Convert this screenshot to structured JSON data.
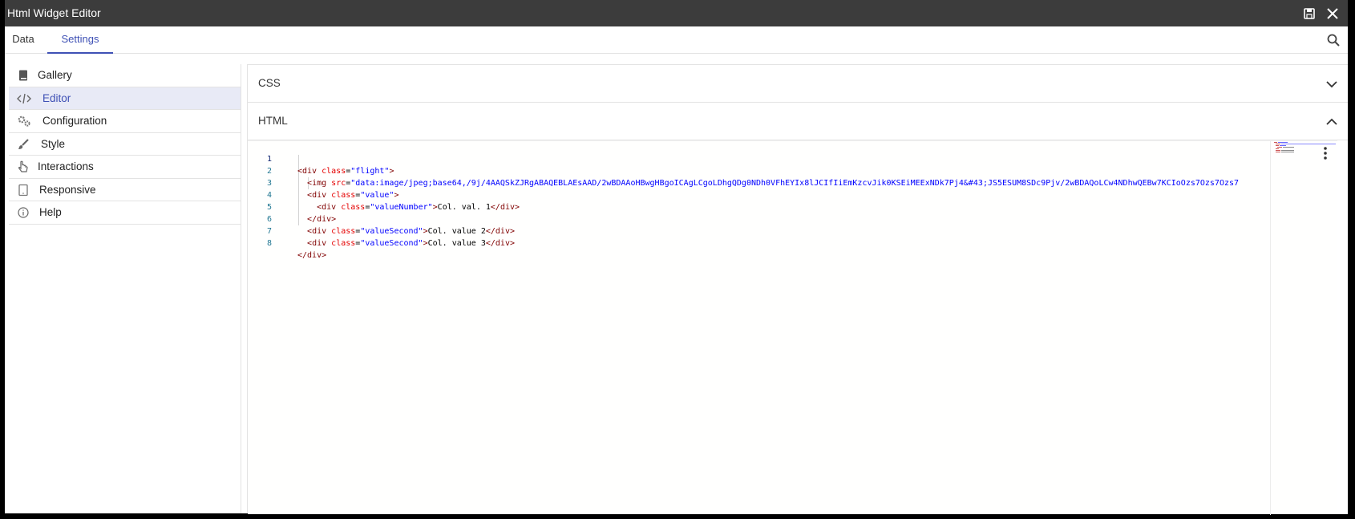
{
  "window": {
    "title": "Html Widget Editor"
  },
  "titlebar": {
    "save_icon": "save-icon",
    "close_icon": "close-icon"
  },
  "tabs": [
    {
      "label": "Data",
      "active": false
    },
    {
      "label": "Settings",
      "active": true
    }
  ],
  "search_icon": "search-icon",
  "sidebar": {
    "items": [
      {
        "label": "Gallery",
        "icon": "book-icon",
        "active": false
      },
      {
        "label": "Editor",
        "icon": "code-icon",
        "active": true
      },
      {
        "label": "Configuration",
        "icon": "gears-icon",
        "active": false
      },
      {
        "label": "Style",
        "icon": "brush-icon",
        "active": false
      },
      {
        "label": "Interactions",
        "icon": "pointer-hand-icon",
        "active": false
      },
      {
        "label": "Responsive",
        "icon": "tablet-icon",
        "active": false
      },
      {
        "label": "Help",
        "icon": "info-icon",
        "active": false
      }
    ]
  },
  "panels": {
    "css": {
      "label": "CSS",
      "expanded": false
    },
    "html": {
      "label": "HTML",
      "expanded": true
    }
  },
  "code": {
    "line_numbers": [
      "1",
      "2",
      "3",
      "4",
      "5",
      "6",
      "7",
      "8"
    ],
    "lines": [
      "<div class=\"flight\">",
      "  <img src=\"data:image/jpeg;base64,/9j/4AAQSkZJRgABAQEBLAEsAAD/2wBDAAoHBwgHBgoICAgLCgoLDhgQDg0NDh0VFhEYIx8lJCIfIiEmKzcvJik0KSEiMEExNDk7Pj4&#43;JS5ESUM8SDc9Pjv/2wBDAQoLCw4NDhwQEBw7KCIoOzs7Ozs7Ozs7",
      "  <div class=\"value\">",
      "    <div class=\"valueNumber\">Col. val. 1</div>",
      "  </div>",
      "  <div class=\"valueSecond\">Col. value 2</div>",
      "  <div class=\"valueSecond\">Col. value 3</div>",
      "</div>"
    ]
  }
}
